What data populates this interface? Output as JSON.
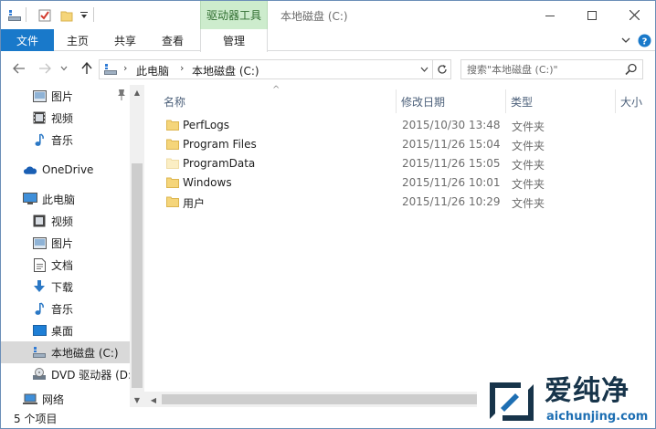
{
  "titlebar": {
    "context_tab": "驱动器工具",
    "title": "本地磁盘 (C:)",
    "icons": [
      "drive-icon",
      "properties-icon",
      "new-folder-icon",
      "customize-qa-icon"
    ]
  },
  "ribbon": {
    "tabs": [
      {
        "label": "文件"
      },
      {
        "label": "主页"
      },
      {
        "label": "共享"
      },
      {
        "label": "查看"
      },
      {
        "label": "管理"
      }
    ]
  },
  "address": {
    "crumbs": [
      "此电脑",
      "本地磁盘 (C:)"
    ],
    "search_placeholder": "搜索\"本地磁盘 (C:)\""
  },
  "nav": {
    "items": [
      {
        "label": "图片",
        "icon": "pictures-icon",
        "pinned": true
      },
      {
        "label": "视频",
        "icon": "videos-icon"
      },
      {
        "label": "音乐",
        "icon": "music-icon"
      },
      {
        "label": "OneDrive",
        "icon": "onedrive-icon"
      },
      {
        "label": "此电脑",
        "icon": "this-pc-icon"
      },
      {
        "label": "视频",
        "icon": "videos-icon"
      },
      {
        "label": "图片",
        "icon": "pictures-icon"
      },
      {
        "label": "文档",
        "icon": "documents-icon"
      },
      {
        "label": "下载",
        "icon": "downloads-icon"
      },
      {
        "label": "音乐",
        "icon": "music-icon"
      },
      {
        "label": "桌面",
        "icon": "desktop-icon"
      },
      {
        "label": "本地磁盘 (C:)",
        "icon": "drive-icon",
        "selected": true
      },
      {
        "label": "DVD 驱动器 (D:",
        "icon": "dvd-icon"
      },
      {
        "label": "网络",
        "icon": "network-icon"
      }
    ]
  },
  "columns": {
    "name": "名称",
    "date": "修改日期",
    "type": "类型",
    "size": "大小"
  },
  "files": [
    {
      "name": "PerfLogs",
      "date": "2015/10/30 13:48",
      "type": "文件夹",
      "hidden": false
    },
    {
      "name": "Program Files",
      "date": "2015/11/26 15:04",
      "type": "文件夹",
      "hidden": false
    },
    {
      "name": "ProgramData",
      "date": "2015/11/26 15:05",
      "type": "文件夹",
      "hidden": true
    },
    {
      "name": "Windows",
      "date": "2015/11/26 10:01",
      "type": "文件夹",
      "hidden": false
    },
    {
      "name": "用户",
      "date": "2015/11/26 10:29",
      "type": "文件夹",
      "hidden": false
    }
  ],
  "status": {
    "count": "5 个项目"
  },
  "watermark": {
    "cn": "爱纯净",
    "en": "aichunjing.com"
  },
  "colors": {
    "file_tab": "#1979ca",
    "context_tab": "#cdeccd",
    "folder": "#f5d57a",
    "selected": "#d9d9d9"
  }
}
